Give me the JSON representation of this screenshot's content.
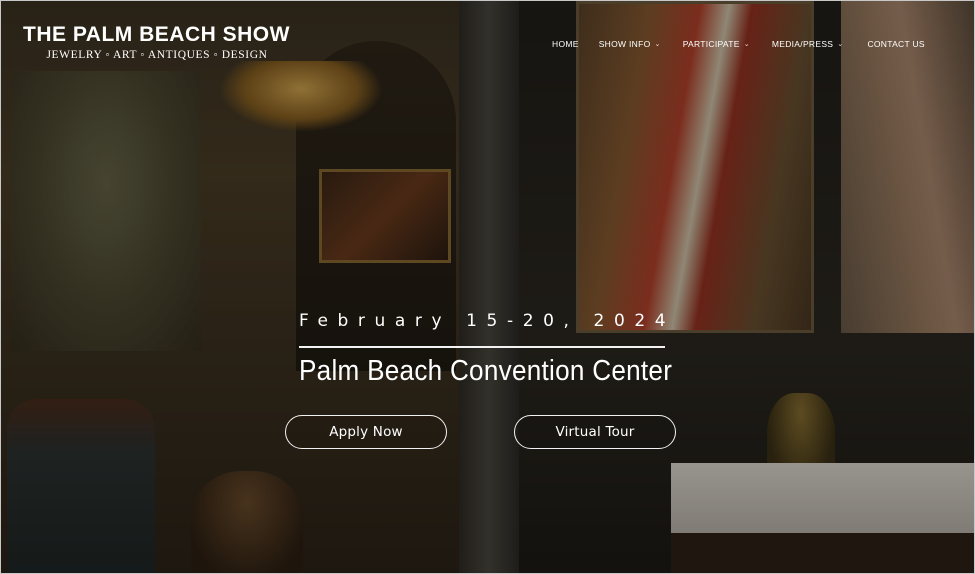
{
  "brand": {
    "title": "THE PALM BEACH SHOW",
    "subtitle": "JEWELRY ◦ ART ◦ ANTIQUES ◦ DESIGN"
  },
  "nav": {
    "items": [
      {
        "label": "HOME",
        "has_dropdown": false
      },
      {
        "label": "SHOW INFO",
        "has_dropdown": true
      },
      {
        "label": "PARTICIPATE",
        "has_dropdown": true
      },
      {
        "label": "MEDIA/PRESS",
        "has_dropdown": true
      },
      {
        "label": "CONTACT US",
        "has_dropdown": false
      }
    ],
    "dropdown_icon": "⌄"
  },
  "hero": {
    "dates": "February 15-20, 2024",
    "venue": "Palm Beach Convention Center",
    "apply_label": "Apply Now",
    "tour_label": "Virtual Tour"
  }
}
